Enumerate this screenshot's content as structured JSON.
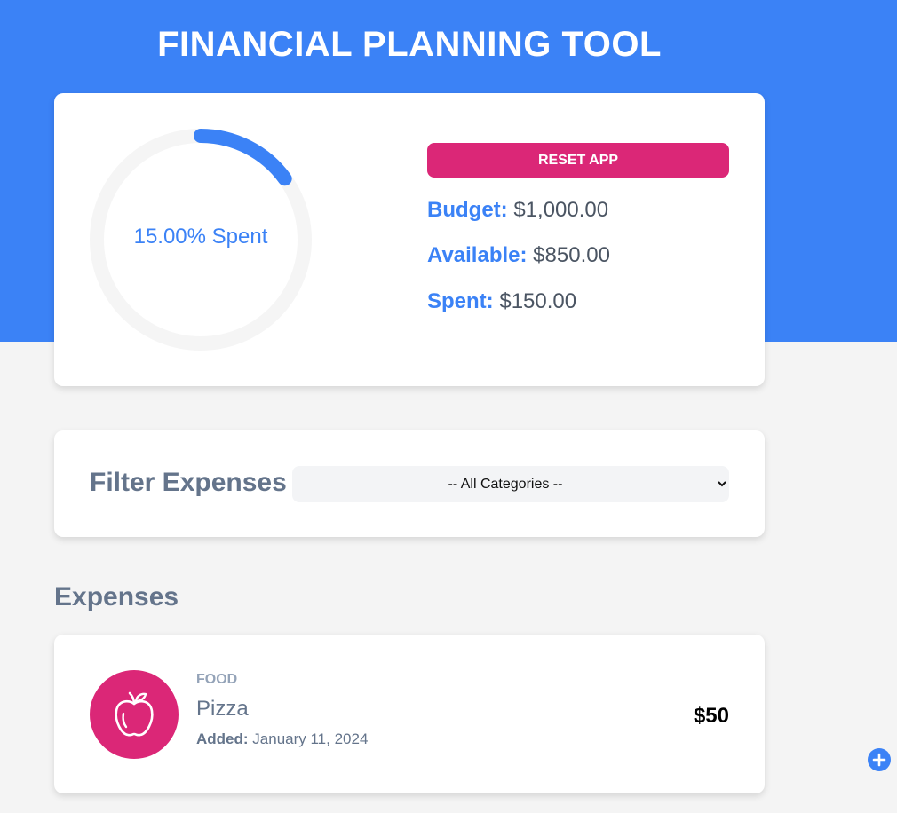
{
  "header": {
    "title": "FINANCIAL PLANNING TOOL"
  },
  "budget": {
    "percent_spent": 15,
    "spent_text": "15.00% Spent",
    "reset_label": "RESET APP",
    "budget_label": "Budget:",
    "budget_value": "$1,000.00",
    "available_label": "Available:",
    "available_value": "$850.00",
    "spent_label": "Spent:",
    "spent_value": "$150.00"
  },
  "filter": {
    "title": "Filter Expenses",
    "selected": "-- All Categories --"
  },
  "expenses": {
    "heading": "Expenses",
    "items": [
      {
        "category": "Food",
        "name": "Pizza",
        "added_label": "Added:",
        "date": "January 11, 2024",
        "amount": "$50",
        "icon": "apple-icon"
      }
    ]
  },
  "colors": {
    "primary": "#3b82f6",
    "accent": "#db2777",
    "text_muted": "#64748b",
    "background": "#f4f4f4",
    "card": "#ffffff"
  }
}
